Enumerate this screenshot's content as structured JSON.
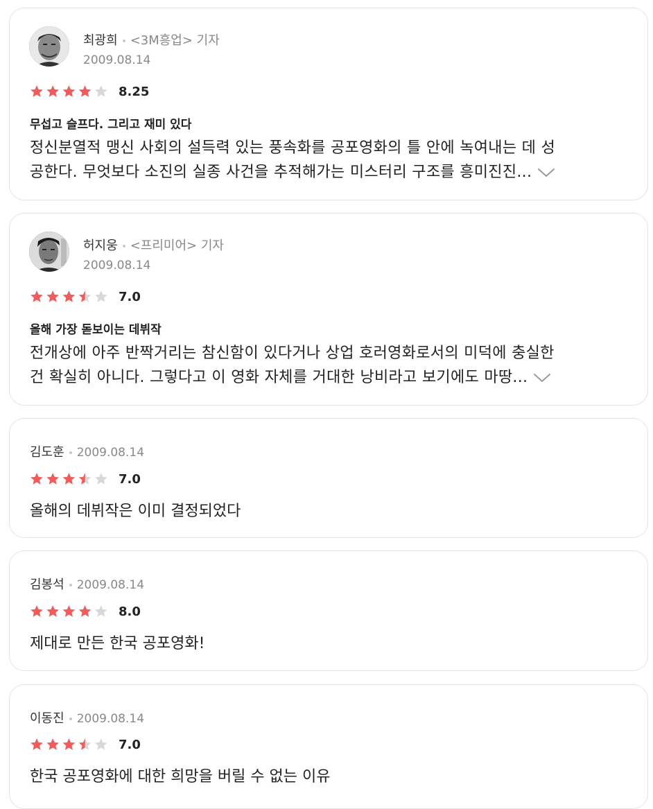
{
  "colors": {
    "star_filled": "#f05b5b",
    "star_empty": "#d8d8d8",
    "border": "#e4e4e4"
  },
  "reviews": [
    {
      "type": "critic",
      "avatar_icon": "critic-portrait-avatar",
      "name": "최광희",
      "outlet": "<3M흥업> 기자",
      "date": "2009.08.14",
      "rating": 4,
      "score": "8.25",
      "headline": "무섭고 슬프다. 그리고 재미 있다",
      "body_line1": "정신분열적 맹신 사회의 설득력 있는 풍속화를 공포영화의 틀 안에 녹여내는 데 성",
      "body_line2": "공한다. 무엇보다 소진의 실종 사건을 추적해가는 미스터리 구조를 흥미진진...",
      "expand_icon": "chevron-down-icon"
    },
    {
      "type": "critic",
      "avatar_icon": "critic-portrait-avatar",
      "name": "허지웅",
      "outlet": "<프리미어> 기자",
      "date": "2009.08.14",
      "rating": 3.5,
      "score": "7.0",
      "headline": "올해 가장 돋보이는 데뷔작",
      "body_line1": "전개상에 아주 반짝거리는 참신함이 있다거나 상업 호러영화로서의 미덕에 충실한",
      "body_line2": "건 확실히 아니다. 그렇다고 이 영화 자체를 거대한 낭비라고 보기에도 마땅...",
      "expand_icon": "chevron-down-icon"
    },
    {
      "type": "simple",
      "name": "김도훈",
      "date": "2009.08.14",
      "rating": 3.5,
      "score": "7.0",
      "comment": "올해의 데뷔작은 이미 결정되었다"
    },
    {
      "type": "simple",
      "name": "김봉석",
      "date": "2009.08.14",
      "rating": 4,
      "score": "8.0",
      "comment": "제대로 만든 한국 공포영화!"
    },
    {
      "type": "simple",
      "name": "이동진",
      "date": "2009.08.14",
      "rating": 3.5,
      "score": "7.0",
      "comment": "한국 공포영화에 대한 희망을 버릴 수 없는 이유"
    }
  ]
}
